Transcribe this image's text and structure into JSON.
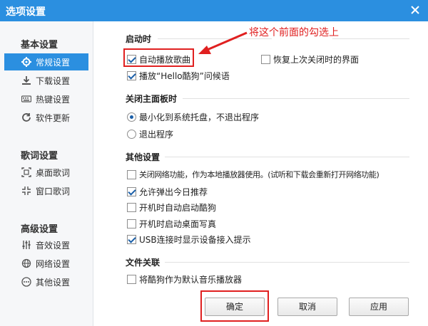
{
  "window": {
    "title": "选项设置"
  },
  "sidebar": {
    "groups": [
      {
        "title": "基本设置",
        "items": [
          {
            "label": "常规设置",
            "icon": "gear-icon",
            "active": true
          },
          {
            "label": "下载设置",
            "icon": "download-icon"
          },
          {
            "label": "热键设置",
            "icon": "keyboard-icon"
          },
          {
            "label": "软件更新",
            "icon": "refresh-icon"
          }
        ]
      },
      {
        "title": "歌词设置",
        "items": [
          {
            "label": "桌面歌词",
            "icon": "desktop-lyrics-icon"
          },
          {
            "label": "窗口歌词",
            "icon": "window-lyrics-icon"
          }
        ]
      },
      {
        "title": "高级设置",
        "items": [
          {
            "label": "音效设置",
            "icon": "equalizer-icon"
          },
          {
            "label": "网络设置",
            "icon": "network-icon"
          },
          {
            "label": "其他设置",
            "icon": "more-icon"
          }
        ]
      }
    ]
  },
  "main": {
    "startup": {
      "title": "启动时",
      "autoplay": {
        "label": "自动播放歌曲",
        "checked": true
      },
      "restore": {
        "label": "恢复上次关闭时的界面",
        "checked": false
      },
      "greeting": {
        "label": "播放“Hello酷狗”问候语",
        "checked": true
      }
    },
    "close_panel": {
      "title": "关闭主面板时",
      "minimize": {
        "label": "最小化到系统托盘，不退出程序",
        "selected": true
      },
      "exit": {
        "label": "退出程序",
        "selected": false
      }
    },
    "other": {
      "title": "其他设置",
      "items": [
        {
          "label": "关闭网络功能，作为本地播放器使用。(试听和下载会重新打开网络功能)",
          "checked": false
        },
        {
          "label": "允许弹出今日推荐",
          "checked": true
        },
        {
          "label": "开机时自动启动酷狗",
          "checked": false
        },
        {
          "label": "开机时启动桌面写真",
          "checked": false
        },
        {
          "label": "USB连接时显示设备接入提示",
          "checked": true
        }
      ]
    },
    "file_assoc": {
      "title": "文件关联",
      "default_player": {
        "label": "将酷狗作为默认音乐播放器",
        "checked": false
      }
    }
  },
  "annotation": {
    "text": "将这个前面的勾选上",
    "color": "#e02020"
  },
  "buttons": {
    "ok": "确定",
    "cancel": "取消",
    "apply": "应用"
  },
  "colors": {
    "titlebar": "#2b8fe0",
    "accent": "#2b8fe0",
    "highlight": "#e02020"
  }
}
